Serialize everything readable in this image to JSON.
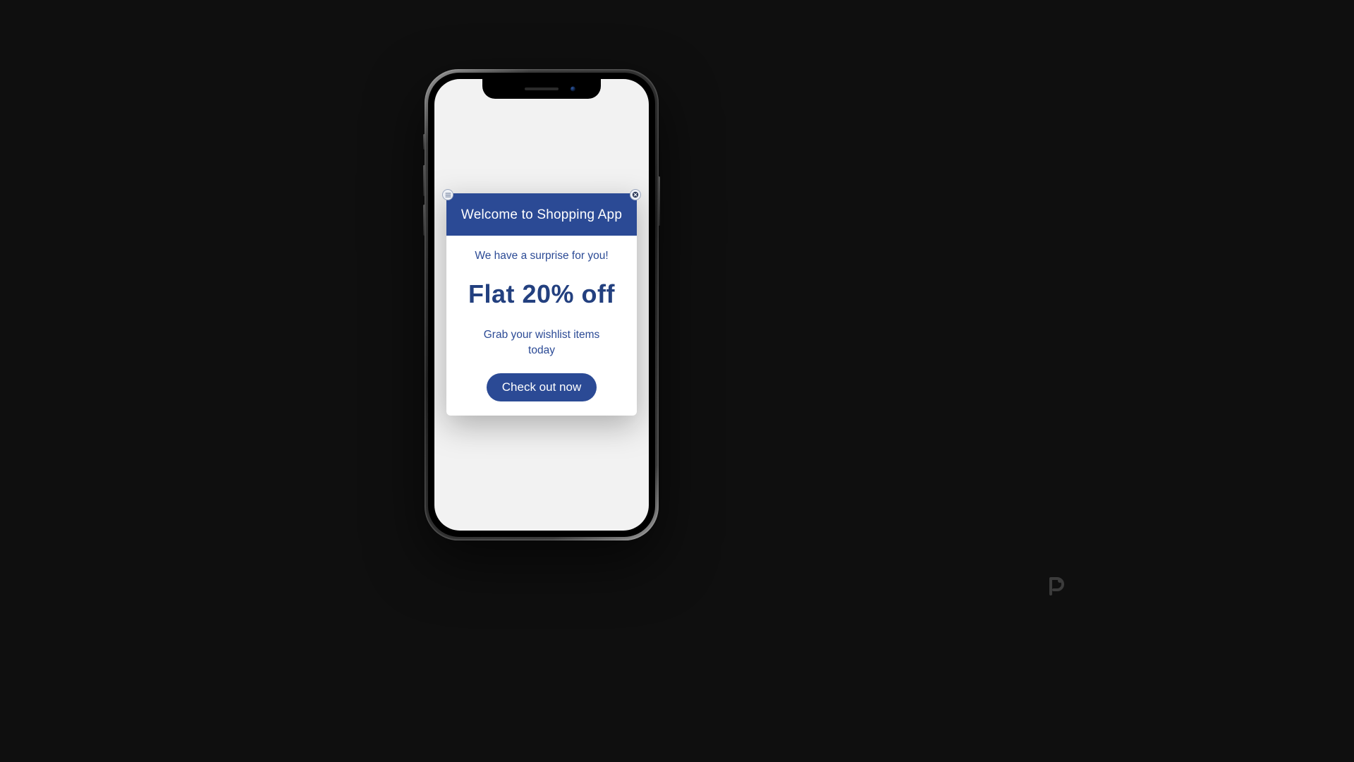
{
  "modal": {
    "title": "Welcome to Shopping App",
    "subtitle": "We have a surprise for you!",
    "headline": "Flat 20% off",
    "description": "Grab your wishlist items today",
    "cta_label": "Check out now"
  },
  "colors": {
    "accent": "#2b4a95",
    "page_bg": "#0f0f0f",
    "screen_bg": "#f2f2f2"
  },
  "icons": {
    "menu": "menu-icon",
    "close": "close-icon"
  },
  "watermark": "P"
}
